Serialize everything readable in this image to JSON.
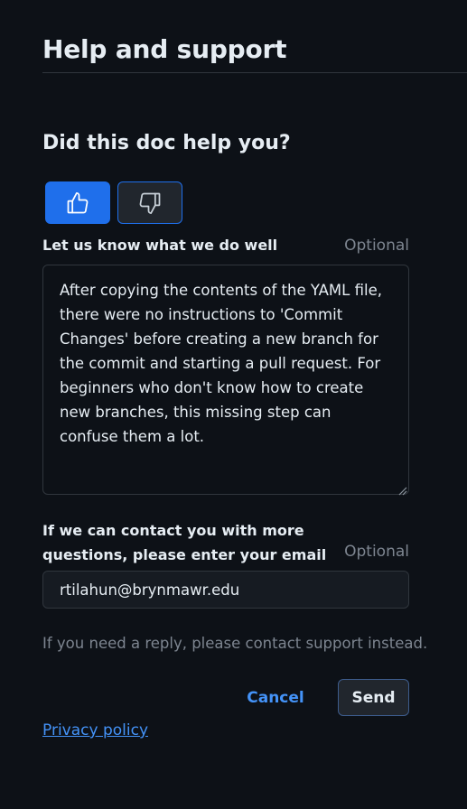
{
  "header": {
    "title": "Help and support"
  },
  "feedback": {
    "question": "Did this doc help you?",
    "thumbs_up_icon": "thumbs-up-icon",
    "thumbs_down_icon": "thumbs-down-icon",
    "selected": "thumbs-up",
    "accent_color": "#1f6feb"
  },
  "comment": {
    "label": "Let us know what we do well",
    "optional": "Optional",
    "value": "After copying the contents of the YAML file, there were no instructions to 'Commit Changes' before creating a new branch for the commit and starting a pull request. For beginners who don't know how to create new branches, this missing step can confuse them a lot."
  },
  "email": {
    "label": "If we can contact you with more questions, please enter your email address",
    "optional": "Optional",
    "value": "rtilahun@brynmawr.edu"
  },
  "note": "If you need a reply, please contact support instead.",
  "actions": {
    "cancel_label": "Cancel",
    "send_label": "Send"
  },
  "footer": {
    "privacy_label": "Privacy policy"
  }
}
